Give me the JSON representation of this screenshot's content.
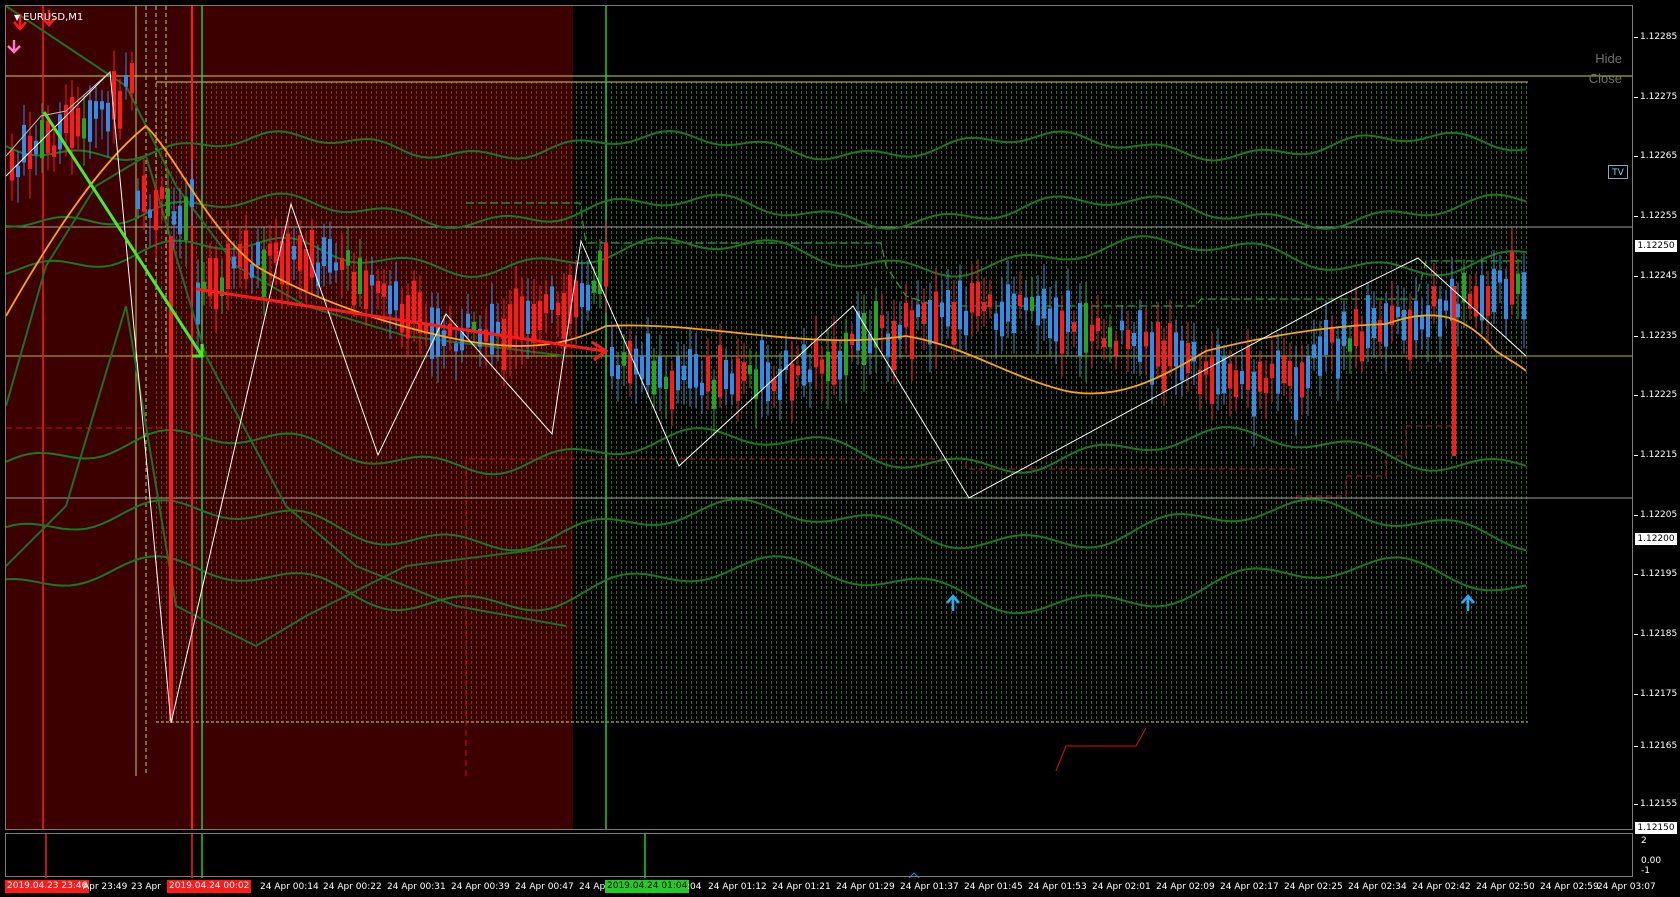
{
  "chart": {
    "symbol": "EURUSD,M1",
    "hide_label": "Hide",
    "close_label": "Close",
    "tv_label": "TV",
    "colors": {
      "background": "#000000",
      "session_fill": "#3d0000",
      "bull_candle": "#2f8ce8",
      "bear_candle": "#ff1a1a",
      "doji_candle": "#1fa81f",
      "bands": "#1a7a1a",
      "moving_average": "#ffa500",
      "zigzag": "#ffffff",
      "level_line": "#d8d800",
      "signal_arrow_up": "#1fb0ff",
      "signal_arrow_down": "#ff1a1a"
    }
  },
  "price_axis": {
    "ticks": [
      "1.12285",
      "1.12275",
      "1.12265",
      "1.12255",
      "1.12245",
      "1.12235",
      "1.12225",
      "1.12215",
      "1.12205",
      "1.12195",
      "1.12185",
      "1.12175",
      "1.12165",
      "1.12155"
    ],
    "markers": [
      "1.12250",
      "1.12200",
      "1.12150"
    ]
  },
  "sub_axis": {
    "ticks": [
      "2",
      "0.00",
      "-1"
    ]
  },
  "time_axis": {
    "ticks": [
      "Apr 23:49",
      "23 Apr",
      "24 Apr 00:14",
      "24 Apr 00:22",
      "24 Apr 00:31",
      "24 Apr 00:39",
      "24 Apr 00:47",
      "24 Apr",
      ":04",
      "24 Apr 01:12",
      "24 Apr 01:21",
      "24 Apr 01:29",
      "24 Apr 01:37",
      "24 Apr 01:45",
      "24 Apr 01:53",
      "24 Apr 02:01",
      "24 Apr 02:09",
      "24 Apr 02:17",
      "24 Apr 02:25",
      "24 Apr 02:34",
      "24 Apr 02:42",
      "24 Apr 02:50",
      "24 Apr 02:59",
      "24 Apr 03:07"
    ],
    "markers": [
      {
        "text": "2019.04.23 23:46",
        "color": "#ff1a1a"
      },
      {
        "text": "2019.04.24 00:02",
        "color": "#ff1a1a"
      },
      {
        "text": "2019.04.24 01:04",
        "color": "#22cc22"
      }
    ]
  }
}
